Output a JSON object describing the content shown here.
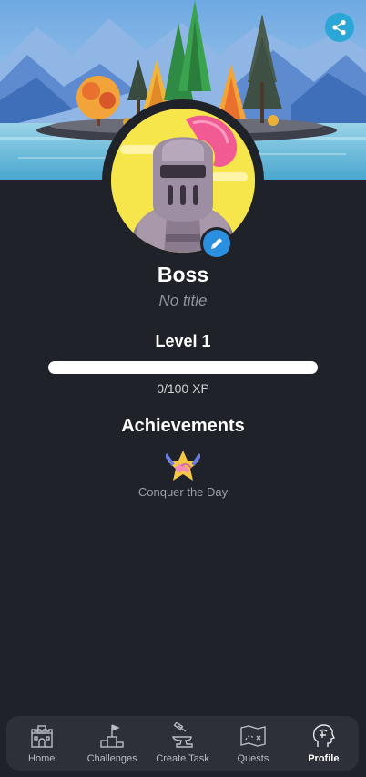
{
  "profile": {
    "name": "Boss",
    "title": "No title",
    "level_label": "Level 1",
    "xp_text": "0/100 XP",
    "xp_progress": 0
  },
  "achievements": {
    "heading": "Achievements",
    "items": [
      {
        "label": "Conquer the Day",
        "icon": "handshake-star-icon"
      }
    ]
  },
  "nav": {
    "items": [
      {
        "label": "Home",
        "icon": "castle-icon",
        "active": false
      },
      {
        "label": "Challenges",
        "icon": "podium-flag-icon",
        "active": false
      },
      {
        "label": "Create Task",
        "icon": "anvil-hammer-icon",
        "active": false
      },
      {
        "label": "Quests",
        "icon": "treasure-map-icon",
        "active": false
      },
      {
        "label": "Profile",
        "icon": "head-profile-icon",
        "active": true
      }
    ]
  },
  "colors": {
    "background": "#1f2229",
    "accent": "#2aa7d6",
    "edit_button": "#2b8fe0",
    "navbar": "#2d3038"
  }
}
